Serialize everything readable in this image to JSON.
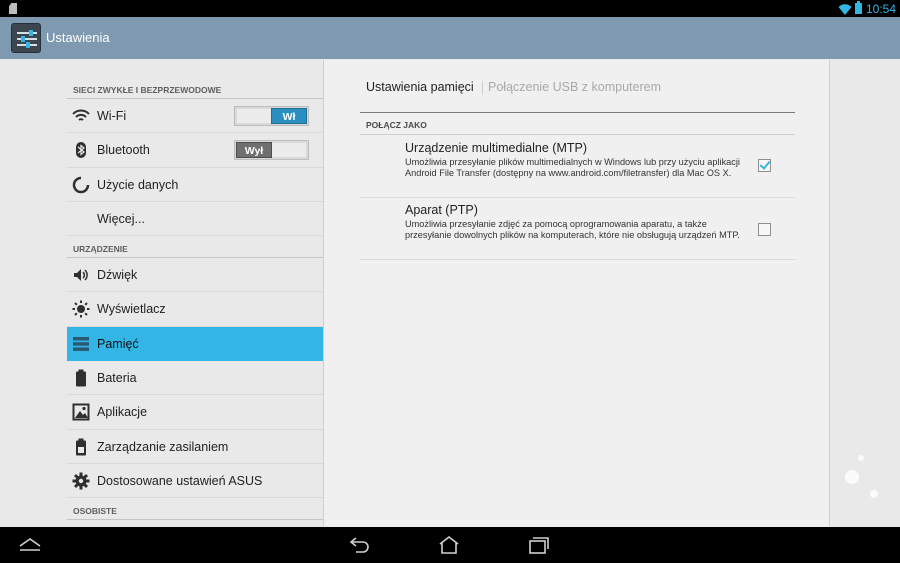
{
  "status_bar": {
    "time": "10:54"
  },
  "action_bar": {
    "title": "Ustawienia"
  },
  "sidebar": {
    "sections": [
      {
        "header": "SIECI ZWYKŁE I BEZPRZEWODOWE"
      },
      {
        "header": "URZĄDZENIE"
      },
      {
        "header": "OSOBISTE"
      }
    ],
    "items": [
      {
        "label": "Wi-Fi",
        "toggle": "Wł",
        "icon": "wifi-icon"
      },
      {
        "label": "Bluetooth",
        "toggle": "Wył",
        "icon": "bluetooth-icon"
      },
      {
        "label": "Użycie danych",
        "icon": "data-usage-icon"
      },
      {
        "label": "Więcej..."
      },
      {
        "label": "Dźwięk",
        "icon": "volume-icon"
      },
      {
        "label": "Wyświetlacz",
        "icon": "brightness-icon"
      },
      {
        "label": "Pamięć",
        "icon": "storage-icon",
        "selected": true
      },
      {
        "label": "Bateria",
        "icon": "battery-icon"
      },
      {
        "label": "Aplikacje",
        "icon": "apps-icon"
      },
      {
        "label": "Zarządzanie zasilaniem",
        "icon": "power-management-icon"
      },
      {
        "label": "Dostosowane ustawień ASUS",
        "icon": "gear-icon"
      }
    ]
  },
  "content": {
    "tabs": [
      {
        "label": "Ustawienia pamięci",
        "active": true
      },
      {
        "label": "Połączenie USB z komputerem",
        "active": false
      }
    ],
    "group_header": "POŁĄCZ JAKO",
    "options": [
      {
        "title": "Urządzenie multimedialne (MTP)",
        "description": "Umożliwia przesyłanie plików multimedialnych w Windows lub przy użyciu aplikacji Android File Transfer (dostępny na www.android.com/filetransfer) dla Mac OS X.",
        "checked": true
      },
      {
        "title": "Aparat (PTP)",
        "description": "Umożliwia przesyłanie zdjęć za pomocą oprogramowania aparatu, a także przesyłanie dowolnych plików na komputerach, które nie obsługują urządzeń MTP.",
        "checked": false
      }
    ]
  },
  "colors": {
    "accent": "#33b5e5",
    "action_bar": "#7f99b1"
  }
}
